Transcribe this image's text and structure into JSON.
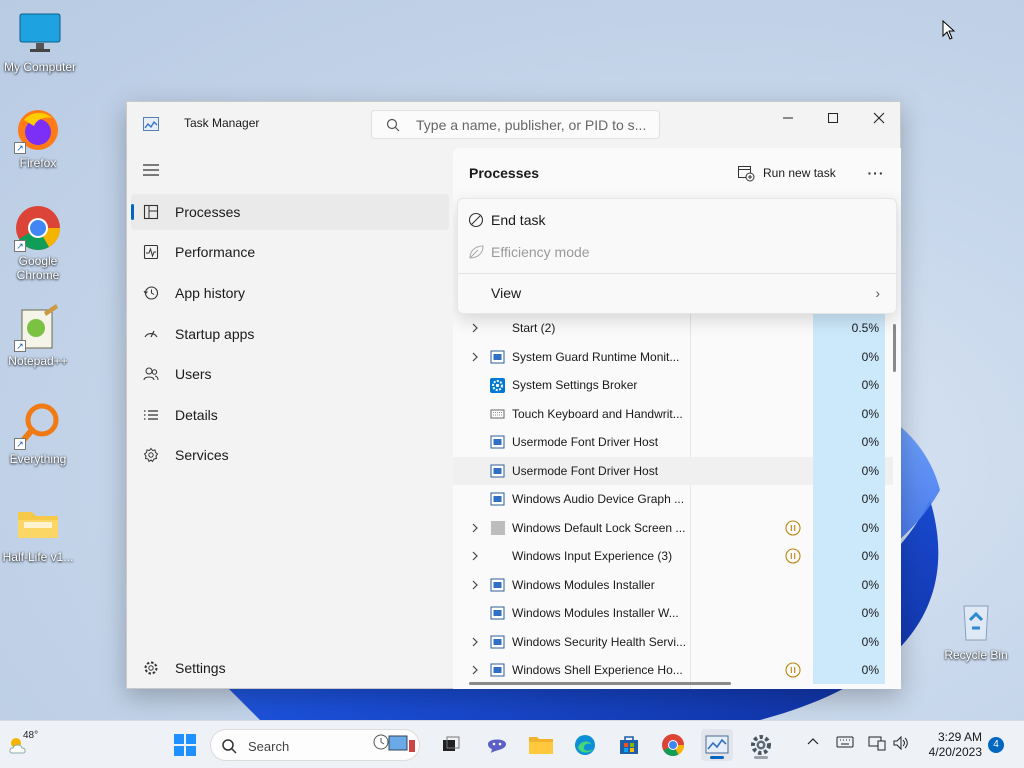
{
  "desktop": {
    "icons": [
      {
        "label": "My Computer"
      },
      {
        "label": "Firefox"
      },
      {
        "label": "Google Chrome"
      },
      {
        "label": "Notepad++"
      },
      {
        "label": "Everything"
      },
      {
        "label": "Half-Life v1..."
      },
      {
        "label": "Recycle Bin"
      }
    ]
  },
  "task_manager": {
    "title": "Task Manager",
    "search": {
      "placeholder": "Type a name, publisher, or PID to s..."
    },
    "nav": [
      {
        "label": "Processes",
        "icon": "processes-icon",
        "active": true
      },
      {
        "label": "Performance",
        "icon": "performance-icon"
      },
      {
        "label": "App history",
        "icon": "app-history-icon"
      },
      {
        "label": "Startup apps",
        "icon": "startup-apps-icon"
      },
      {
        "label": "Users",
        "icon": "users-icon"
      },
      {
        "label": "Details",
        "icon": "details-icon"
      },
      {
        "label": "Services",
        "icon": "services-icon"
      }
    ],
    "settings_label": "Settings",
    "main": {
      "title": "Processes",
      "run_new_task": "Run new task",
      "more": "···"
    },
    "context_menu": {
      "end_task": "End task",
      "efficiency_mode": "Efficiency mode",
      "view": "View"
    },
    "processes": [
      {
        "name": "Start (2)",
        "cpu": "0.5%",
        "expandable": true,
        "icon": "none",
        "paused": false
      },
      {
        "name": "System Guard Runtime Monit...",
        "cpu": "0%",
        "expandable": true,
        "icon": "window",
        "paused": false
      },
      {
        "name": "System Settings Broker",
        "cpu": "0%",
        "expandable": false,
        "icon": "gear",
        "paused": false
      },
      {
        "name": "Touch Keyboard and Handwrit...",
        "cpu": "0%",
        "expandable": false,
        "icon": "keyboard",
        "paused": false
      },
      {
        "name": "Usermode Font Driver Host",
        "cpu": "0%",
        "expandable": false,
        "icon": "window",
        "paused": false
      },
      {
        "name": "Usermode Font Driver Host",
        "cpu": "0%",
        "expandable": false,
        "icon": "window",
        "paused": false,
        "highlight": true
      },
      {
        "name": "Windows Audio Device Graph ...",
        "cpu": "0%",
        "expandable": false,
        "icon": "window",
        "paused": false
      },
      {
        "name": "Windows Default Lock Screen ...",
        "cpu": "0%",
        "expandable": true,
        "icon": "gray",
        "paused": true
      },
      {
        "name": "Windows Input Experience (3)",
        "cpu": "0%",
        "expandable": true,
        "icon": "none",
        "paused": true
      },
      {
        "name": "Windows Modules Installer",
        "cpu": "0%",
        "expandable": true,
        "icon": "window",
        "paused": false
      },
      {
        "name": "Windows Modules Installer W...",
        "cpu": "0%",
        "expandable": false,
        "icon": "window",
        "paused": false
      },
      {
        "name": "Windows Security Health Servi...",
        "cpu": "0%",
        "expandable": true,
        "icon": "window",
        "paused": false
      },
      {
        "name": "Windows Shell Experience Ho...",
        "cpu": "0%",
        "expandable": true,
        "icon": "window",
        "paused": true
      }
    ]
  },
  "taskbar": {
    "weather": "48°",
    "search_label": "Search",
    "time": "3:29 AM",
    "date": "4/20/2023",
    "notifications": "4"
  },
  "colors": {
    "accent": "#0067c0",
    "cpu_highlight": "#cce8fb",
    "pause_icon": "#b8860b"
  }
}
